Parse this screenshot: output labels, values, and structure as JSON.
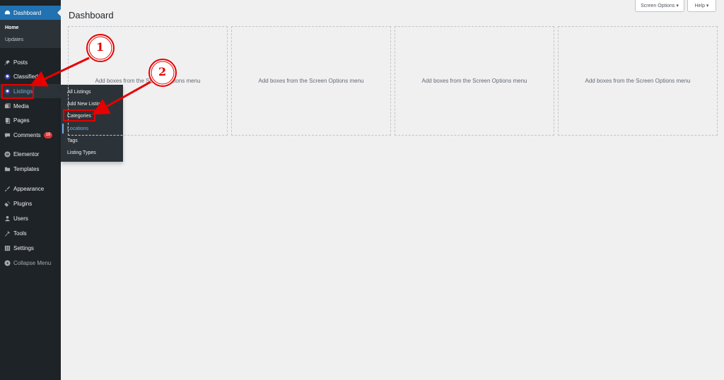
{
  "sidebar": {
    "dashboard": "Dashboard",
    "home": "Home",
    "updates": "Updates",
    "posts": "Posts",
    "classified": "Classified L",
    "listings": "Listings",
    "media": "Media",
    "pages": "Pages",
    "comments": "Comments",
    "comments_count": "18",
    "elementor": "Elementor",
    "templates": "Templates",
    "appearance": "Appearance",
    "plugins": "Plugins",
    "users": "Users",
    "tools": "Tools",
    "settings": "Settings",
    "collapse": "Collapse Menu"
  },
  "flyout": {
    "all_listings": "All Listings",
    "add_new": "Add New Listin",
    "categories": "Categories",
    "locations": "Locations",
    "tags": "Tags",
    "listing_types": "Listing Types"
  },
  "header": {
    "title": "Dashboard",
    "screen_options": "Screen Options ▾",
    "help": "Help ▾"
  },
  "main": {
    "boxes": [
      "Add boxes from the Screen Options menu",
      "Add boxes from the Screen Options menu",
      "Add boxes from the Screen Options menu",
      "Add boxes from the Screen Options menu"
    ]
  },
  "annotations": {
    "step1": "1",
    "step2": "2",
    "color": "#e60000"
  },
  "colors": {
    "sidebar_bg": "#1d2327",
    "accent": "#2271b1",
    "active_link": "#72aee6",
    "page_bg": "#f0f0f1"
  }
}
